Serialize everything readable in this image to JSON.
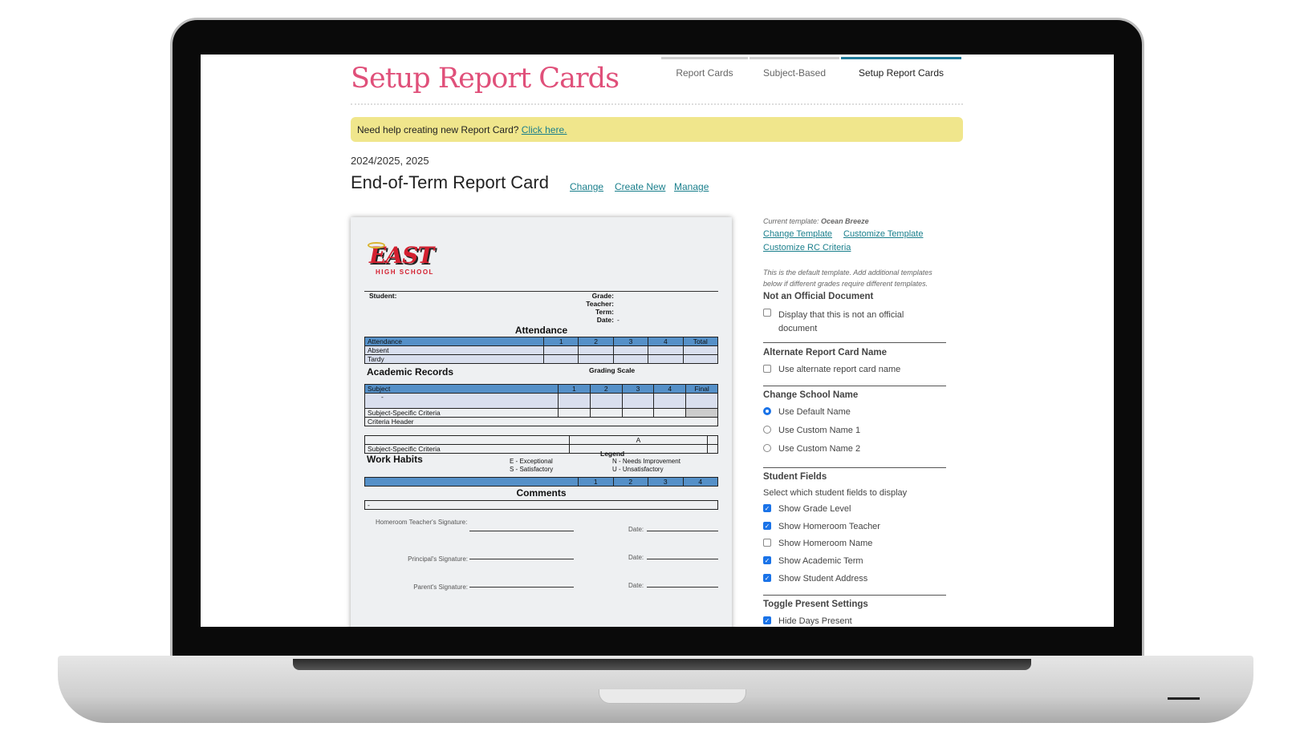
{
  "page": {
    "title": "Setup Report Cards",
    "tabs": [
      {
        "label": "Report Cards",
        "active": false
      },
      {
        "label": "Subject-Based",
        "active": false
      },
      {
        "label": "Setup Report Cards",
        "active": true
      }
    ],
    "banner": {
      "text": "Need help creating new Report Card?",
      "link": "Click here."
    },
    "year": "2024/2025, 2025",
    "heading": "End-of-Term Report Card",
    "heading_links": [
      "Change",
      "Create New",
      "Manage"
    ]
  },
  "colors": {
    "title": "#e0507a",
    "banner": "#f0e68c",
    "link": "#1a7f8c",
    "table_header": "#5590c8",
    "active_tab": "#1f7a99"
  },
  "preview": {
    "logo": {
      "name": "EAST",
      "sub": "HIGH SCHOOL"
    },
    "student": "Student:",
    "fields": [
      "Grade:",
      "Teacher:",
      "Term:",
      "Date:"
    ],
    "date_value": "-",
    "attendance": {
      "title": "Attendance",
      "header": [
        "Attendance",
        "1",
        "2",
        "3",
        "4",
        "Total"
      ],
      "rows": [
        "Absent",
        "Tardy"
      ]
    },
    "academic": {
      "title": "Academic Records",
      "grading_scale": "Grading Scale",
      "header": [
        "Subject",
        "1",
        "2",
        "3",
        "4",
        "Final"
      ],
      "row_dash": "-",
      "ssc": "Subject-Specific Criteria",
      "criteria_header": "Criteria Header",
      "grade": "A"
    },
    "work_habits": {
      "title": "Work Habits",
      "legend_title": "Legend",
      "legend": [
        "E - Exceptional",
        "S - Satisfactory",
        "N - Needs Improvement",
        "U - Unsatisfactory"
      ],
      "cols": [
        "1",
        "2",
        "3",
        "4"
      ]
    },
    "comments": {
      "title": "Comments",
      "value": "-"
    },
    "signatures": [
      "Homeroom Teacher's Signature:",
      "Principal's Signature:",
      "Parent's Signature:"
    ],
    "date_label": "Date:"
  },
  "panel": {
    "current_template_label": "Current template:",
    "current_template": "Ocean Breeze",
    "links": [
      "Change Template",
      "Customize Template",
      "Customize RC Criteria"
    ],
    "note": [
      "This is the default template. Add additional templates",
      "below if different grades require different templates."
    ],
    "not_official": {
      "title": "Not an Official Document",
      "option": [
        "Display that this is not an official",
        "document"
      ],
      "checked": false
    },
    "alt_name": {
      "title": "Alternate Report Card Name",
      "option": "Use alternate report card name",
      "checked": false
    },
    "school_name": {
      "title": "Change School Name",
      "options": [
        {
          "label": "Use Default Name",
          "selected": true
        },
        {
          "label": "Use Custom Name 1",
          "selected": false
        },
        {
          "label": "Use Custom Name 2",
          "selected": false
        }
      ]
    },
    "student_fields": {
      "title": "Student Fields",
      "desc": "Select which student fields to display",
      "options": [
        {
          "label": "Show Grade Level",
          "checked": true
        },
        {
          "label": "Show Homeroom Teacher",
          "checked": true
        },
        {
          "label": "Show Homeroom Name",
          "checked": false
        },
        {
          "label": "Show Academic Term",
          "checked": true
        },
        {
          "label": "Show Student Address",
          "checked": true
        }
      ]
    },
    "present": {
      "title": "Toggle Present Settings",
      "options": [
        {
          "label": "Hide Days Present",
          "checked": true
        }
      ]
    }
  }
}
